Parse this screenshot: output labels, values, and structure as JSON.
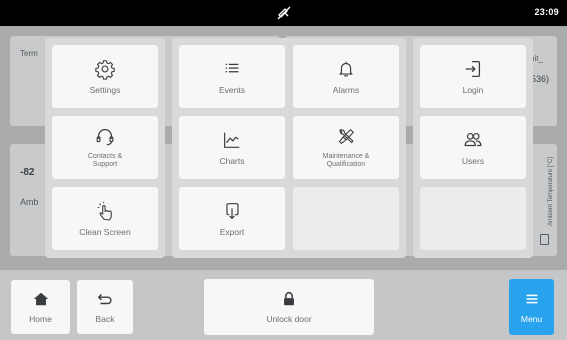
{
  "status_bar": {
    "clock": "23:09"
  },
  "background": {
    "left_label_1": "Term",
    "right_label_1": "nit_",
    "right_label_2": "536)",
    "left_value": "-82",
    "left_label_2": "Amb",
    "right_vertical_label": "Ambient Temperature [°C]"
  },
  "menu": {
    "settings": "Settings",
    "events": "Events",
    "alarms": "Alarms",
    "login": "Login",
    "contacts_support": [
      "Contacts &",
      "Support"
    ],
    "charts": "Charts",
    "maintenance": [
      "Maintenance &",
      "Qualification"
    ],
    "users": "Users",
    "clean_screen": "Clean Screen",
    "export": "Export"
  },
  "bottom_bar": {
    "home": "Home",
    "back": "Back",
    "unlock_door": "Unlock door",
    "menu": "Menu"
  },
  "colors": {
    "accent_blue": "#2aa3ef",
    "status_bar": "#000000",
    "tile": "#f7f7f7",
    "icon": "#3a3d40"
  }
}
